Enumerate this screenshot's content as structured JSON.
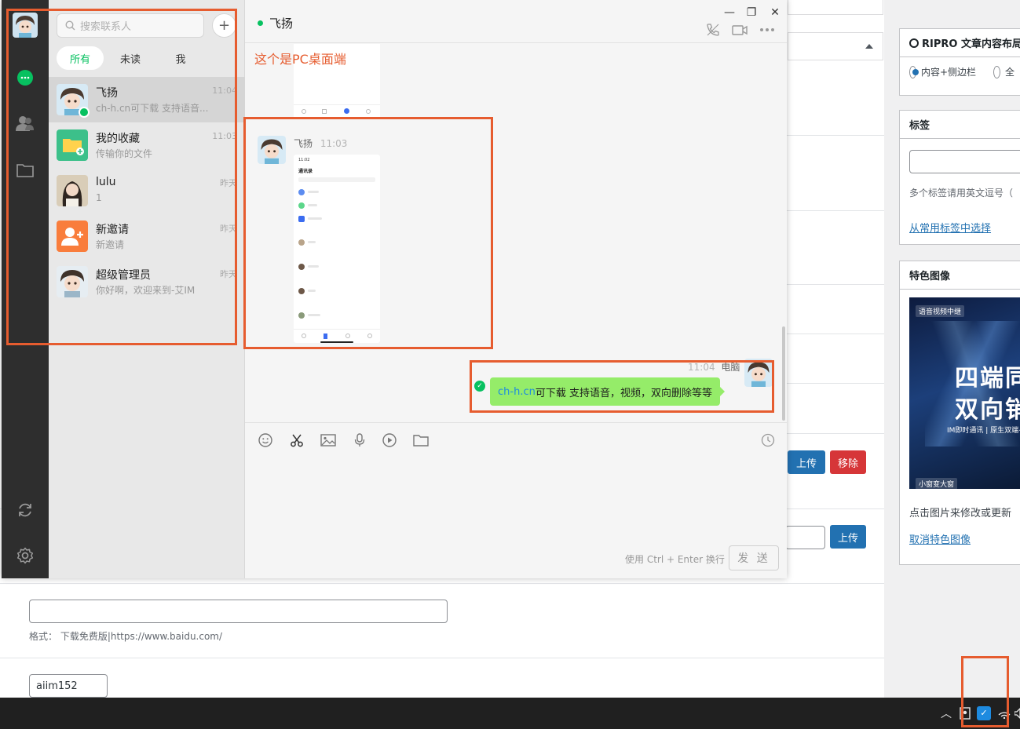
{
  "chat_app": {
    "search_placeholder": "搜索联系人",
    "add_button": "+",
    "tabs": [
      "所有",
      "未读",
      "我"
    ],
    "conversations": [
      {
        "name": "飞扬",
        "preview": "ch-h.cn可下载 支持语音...",
        "time": "11:04"
      },
      {
        "name": "我的收藏",
        "preview": "传输你的文件",
        "time": "11:03"
      },
      {
        "name": "lulu",
        "preview": "1",
        "time": "昨天"
      },
      {
        "name": "新邀请",
        "preview": "新邀请",
        "time": "昨天"
      },
      {
        "name": "超级管理员",
        "preview": "你好啊，欢迎来到-艾IM",
        "time": "昨天"
      }
    ],
    "chat_title": "飞扬",
    "window_controls": {
      "minimize": "—",
      "maximize": "❐",
      "close": "✕"
    },
    "header_icons": [
      "phone-icon",
      "video-icon",
      "more-icon"
    ],
    "messages": {
      "received": {
        "sender": "飞扬",
        "time": "11:03"
      },
      "sent": {
        "time": "11:04",
        "device": "电脑",
        "link": "ch-h.cn",
        "text": "可下载 支持语音，视频，双向删除等等"
      }
    },
    "phone_screenshot": {
      "status_time": "11:02",
      "title": "通讯录"
    },
    "toolbar_icons": [
      "emoji-icon",
      "scissors-icon",
      "image-icon",
      "mic-icon",
      "play-icon",
      "folder-icon",
      "history-icon"
    ],
    "send_hint": "使用 Ctrl + Enter 换行",
    "send_label": "发 送"
  },
  "annotation_text": "这个是PC桌面端",
  "wp": {
    "upload_label": "上传",
    "remove_label": "移除",
    "upload_label_2": "上传",
    "format_hint": "格式： 下载免费版|https://www.baidu.com/",
    "input_value": "aiim152",
    "layout_box": {
      "title": "RIPRO 文章内容布局",
      "option1": "内容+侧边栏",
      "option2": "全"
    },
    "tags_box": {
      "title": "标签",
      "hint": "多个标签请用英文逗号（",
      "link": "从常用标签中选择"
    },
    "featured_box": {
      "title": "特色图像",
      "image_tag_top": "语音视频中继",
      "image_line1": "四端同",
      "image_line2": "双向销",
      "image_sub": "IM即时通讯 | 原生双端+PC",
      "image_tag_bottom": "小窗变大窗",
      "edit_hint": "点击图片来修改或更新",
      "remove_link": "取消特色图像"
    }
  },
  "colors": {
    "accent_green": "#07c160",
    "bubble": "#95ec69",
    "annotation": "#e65c2f",
    "wp_blue": "#2271b1",
    "wp_red": "#d63638"
  }
}
